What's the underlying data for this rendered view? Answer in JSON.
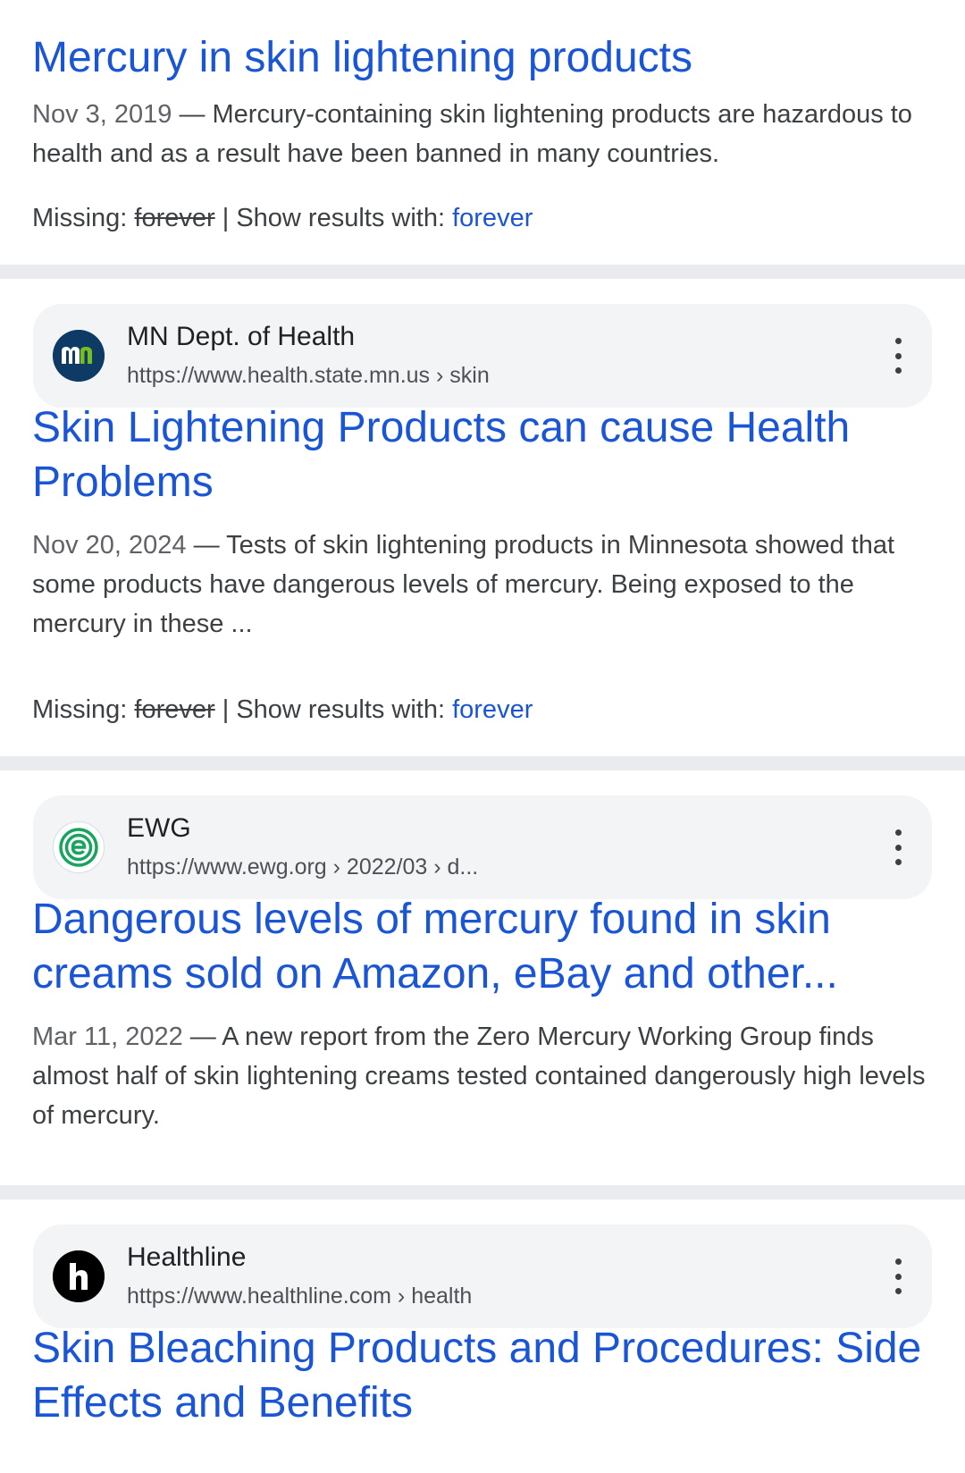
{
  "results": [
    {
      "title": "Mercury in skin lightening products",
      "date": "Nov 3, 2019",
      "sep": " — ",
      "snippet": "Mercury-containing skin lightening products are hazardous to health and as a result have been banned in many countries.",
      "missing_label": "Missing: ",
      "missing_term": "forever",
      "show_label": " | Show results with: ",
      "show_term": "forever"
    },
    {
      "site_name": "MN Dept. of Health",
      "url": "https://www.health.state.mn.us › skin",
      "favicon_text": "mn",
      "title": "Skin Lightening Products can cause Health Problems",
      "date": "Nov 20, 2024",
      "sep": " — ",
      "snippet": "Tests of skin lightening products in Minnesota showed that some products have dangerous levels of mercury. Being exposed to the mercury in these ...",
      "missing_label": "Missing: ",
      "missing_term": "forever",
      "show_label": " | Show results with: ",
      "show_term": "forever"
    },
    {
      "site_name": "EWG",
      "url": "https://www.ewg.org › 2022/03 › d...",
      "title": "Dangerous levels of mercury found in skin creams sold on Amazon, eBay and other...",
      "date": "Mar 11, 2022",
      "sep": " — ",
      "snippet": "A new report from the Zero Mercury Working Group finds almost half of skin lightening creams tested contained dangerously high levels of mercury."
    },
    {
      "site_name": "Healthline",
      "url": "https://www.healthline.com › health",
      "favicon_text": "h",
      "title": "Skin Bleaching Products and Procedures: Side Effects and Benefits"
    }
  ],
  "colors": {
    "link": "#1a55d6",
    "snippet": "#3c4043",
    "divider": "#eaebef",
    "chip": "#f3f4f6",
    "ewg_green": "#1aa260",
    "mn_blue": "#0d3b66",
    "mn_green": "#78be20"
  },
  "icons": {
    "more": "more-vert-icon"
  }
}
